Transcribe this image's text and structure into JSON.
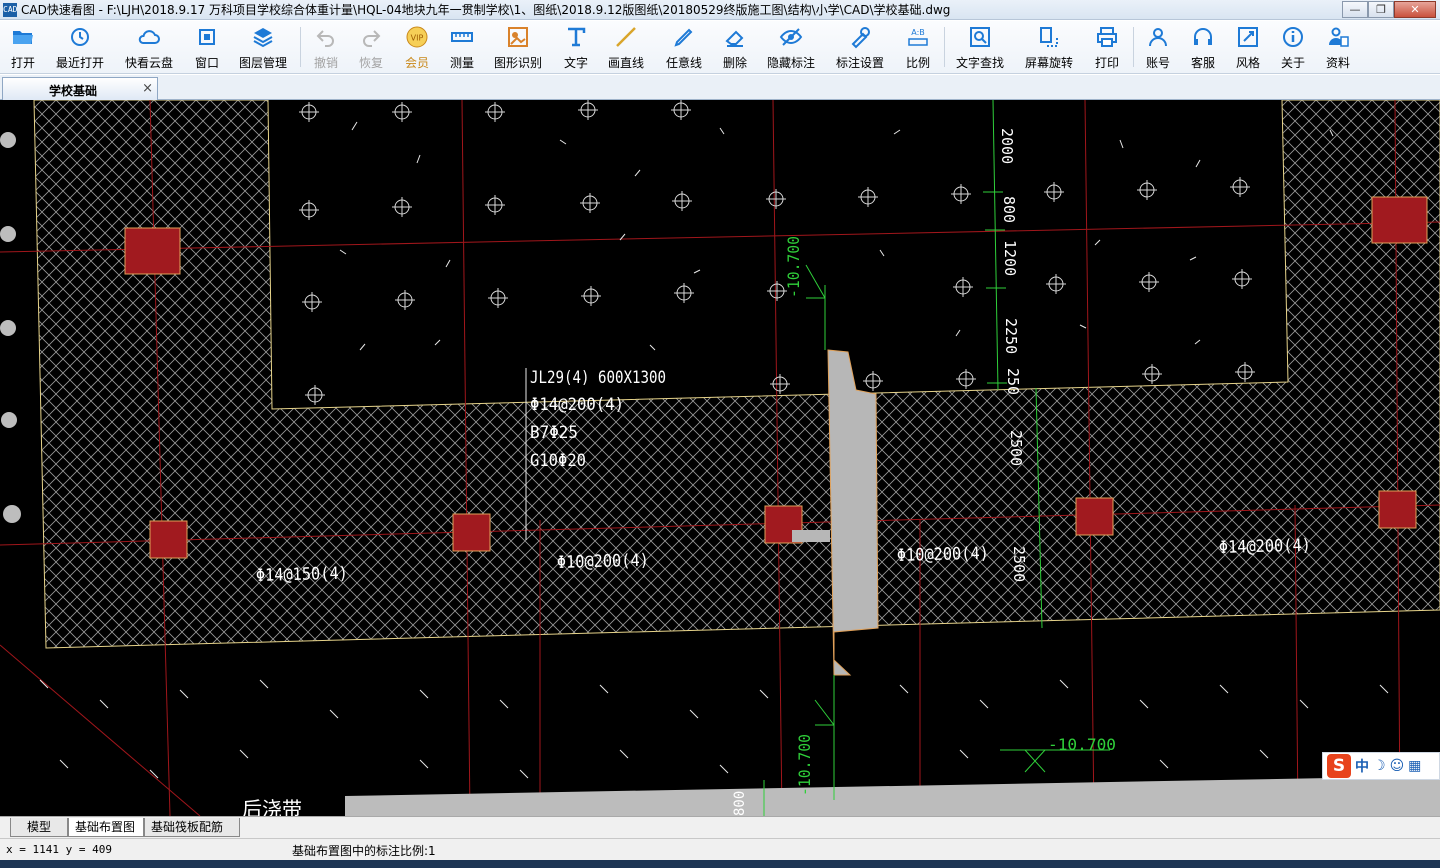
{
  "window": {
    "title": "CAD快速看图 - F:\\LJH\\2018.9.17 万科项目学校综合体重计量\\HQL-04地块九年一贯制学校\\1、图纸\\2018.9.12版图纸\\20180529终版施工图\\结构\\小学\\CAD\\学校基础.dwg",
    "app_icon_text": "CAD",
    "minimize": "—",
    "restore": "❐",
    "close": "✕"
  },
  "toolbar": {
    "open": "打开",
    "recent": "最近打开",
    "cloud": "快看云盘",
    "window": "窗口",
    "layers": "图层管理",
    "undo": "撤销",
    "redo": "恢复",
    "vip": "会员",
    "measure": "测量",
    "shape_recognize": "图形识别",
    "text": "文字",
    "line": "画直线",
    "freehand": "任意线",
    "erase": "删除",
    "hide_dims": "隐藏标注",
    "dim_settings": "标注设置",
    "scale": "比例",
    "text_search": "文字查找",
    "rotate_screen": "屏幕旋转",
    "print": "打印",
    "account": "账号",
    "support": "客服",
    "style": "风格",
    "about": "关于",
    "resources": "资料"
  },
  "document_tab": {
    "label": "学校基础",
    "close": "×"
  },
  "drawing": {
    "beam_label": [
      "JL29(4) 600X1300",
      "Φ14@200(4)",
      "B7Φ25",
      "G10Φ20"
    ],
    "rebar_labels": [
      "Φ14@150(4)",
      "Φ10@200(4)",
      "Φ10@200(4)",
      "Φ14@200(4)"
    ],
    "dims_vertical": [
      "2000",
      "800",
      "1200",
      "2250",
      "250",
      "2500",
      "2500"
    ],
    "elev_labels": [
      "-10.700",
      "-10.700",
      "-10.700"
    ],
    "bottom_dim": "800",
    "bottom_text": "后浇带"
  },
  "ime": {
    "logo": "S",
    "mode": "中",
    "moon": "☽",
    "smile": "☺",
    "grid": "▦"
  },
  "layout_tabs": [
    "模型",
    "基础布置图",
    "基础筏板配筋图"
  ],
  "status": {
    "coords": "x = 1141  y = 409",
    "scale_message": "基础布置图中的标注比例:1"
  }
}
